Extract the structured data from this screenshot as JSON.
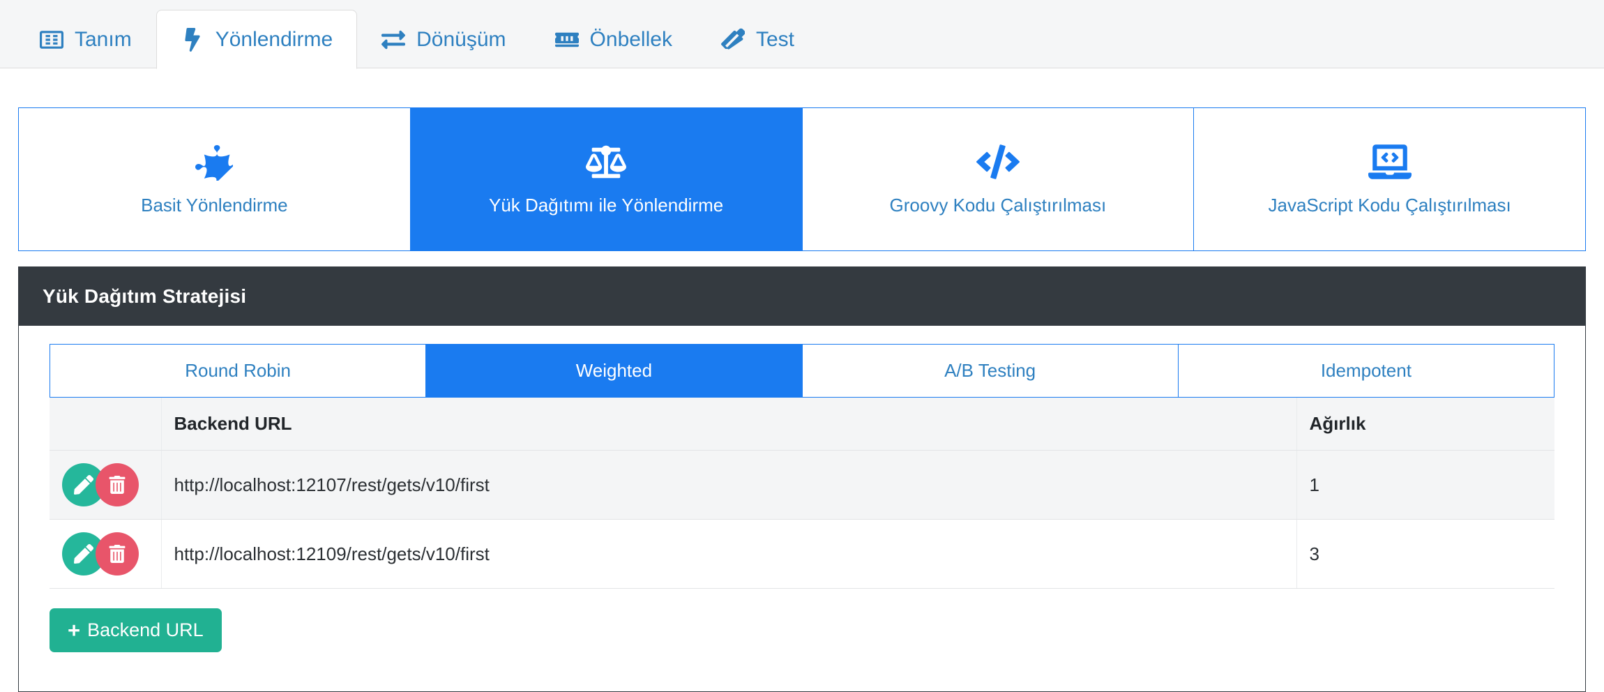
{
  "tabs": [
    {
      "label": "Tanım",
      "icon": "id-card-icon",
      "active": false
    },
    {
      "label": "Yönlendirme",
      "icon": "bolt-icon",
      "active": true
    },
    {
      "label": "Dönüşüm",
      "icon": "exchange-icon",
      "active": false
    },
    {
      "label": "Önbellek",
      "icon": "memory-chip-icon",
      "active": false
    },
    {
      "label": "Test",
      "icon": "marker-pen-icon",
      "active": false
    }
  ],
  "routing_cards": [
    {
      "label": "Basit Yönlendirme",
      "icon": "puzzle-piece-icon",
      "active": false
    },
    {
      "label": "Yük Dağıtımı ile Yönlendirme",
      "icon": "balance-scale-icon",
      "active": true
    },
    {
      "label": "Groovy Kodu Çalıştırılması",
      "icon": "code-icon",
      "active": false
    },
    {
      "label": "JavaScript Kodu Çalıştırılması",
      "icon": "laptop-code-icon",
      "active": false
    }
  ],
  "panel": {
    "title": "Yük Dağıtım Stratejisi"
  },
  "strategies": [
    {
      "label": "Round Robin",
      "active": false
    },
    {
      "label": "Weighted",
      "active": true
    },
    {
      "label": "A/B Testing",
      "active": false
    },
    {
      "label": "Idempotent",
      "active": false
    }
  ],
  "table": {
    "columns": [
      "",
      "Backend URL",
      "Ağırlık"
    ],
    "rows": [
      {
        "url": "http://localhost:12107/rest/gets/v10/first",
        "weight": "1"
      },
      {
        "url": "http://localhost:12109/rest/gets/v10/first",
        "weight": "3"
      }
    ],
    "row_actions": {
      "edit": "edit-icon",
      "delete": "delete-icon"
    }
  },
  "add_button": {
    "plus": "+",
    "label": "Backend URL"
  },
  "colors": {
    "accent_blue": "#1a7bf0",
    "link_blue": "#2e80c0",
    "dark_header": "#343a40",
    "green": "#21b192",
    "red": "#e8556a"
  }
}
